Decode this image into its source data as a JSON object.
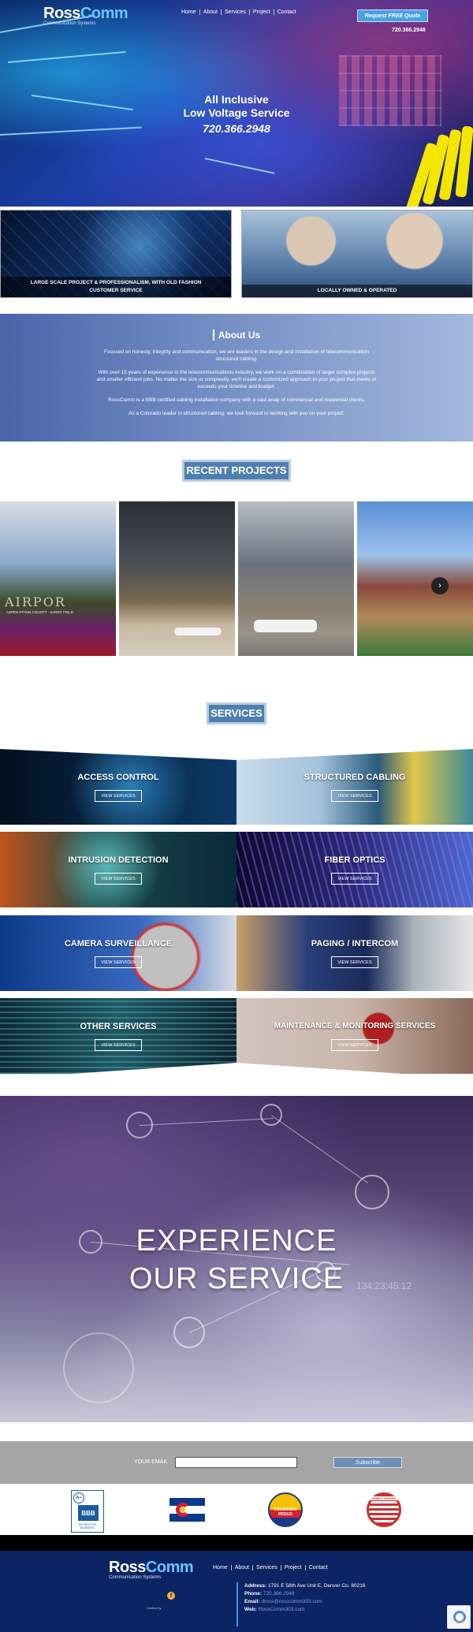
{
  "header": {
    "logo_brand_ross": "Ross",
    "logo_brand_comm": "Comm",
    "logo_tagline": "Communication Systems",
    "nav": [
      "Home",
      "About",
      "Services",
      "Project",
      "Contact"
    ],
    "quote_button": "Request FREE Quote",
    "phone": "720.366.2948"
  },
  "hero": {
    "title_line1": "All Inclusive",
    "title_line2": "Low Voltage Service",
    "phone": "720.366.2948"
  },
  "features": [
    {
      "caption": "LARGE SCALE PROJECT & PROFESSIONALISM, WITH OLD FASHION CUSTOMER SERVICE"
    },
    {
      "caption": "LOCALLY OWNED & OPERATED"
    }
  ],
  "about": {
    "title": "About Us",
    "paragraphs": [
      "Focused on honesty, integrity and communication, we are leaders in the design and installation of telecommunication structured cabling.",
      "With over 15 years of experience in the telecommunications industry, we work on a combination of larger complex projects and smaller efficient jobs. No matter the size or complexity, we'll create a customized approach to your project that meets or exceeds your timeline and budget.",
      "RossComm is a BBB certified cabling installation company with a vast array of commercial and residential clients.",
      "As a Colorado leader in structured cabling, we look forward to working with you on your project."
    ]
  },
  "projects": {
    "title": "RECENT PROJECTS",
    "airport_sign": "AIRPOR",
    "airport_subsign": "ASPEN-PITKIN COUNTY · SARDY FIELD",
    "next_icon": "›"
  },
  "services": {
    "title": "SERVICES",
    "button_label": "VIEW SERVICES",
    "items": [
      {
        "title": "ACCESS CONTROL"
      },
      {
        "title": "STRUCTURED CABLING"
      },
      {
        "title": "INTRUSION DETECTION"
      },
      {
        "title": "FIBER OPTICS"
      },
      {
        "title": "CAMERA SURVEILLANCE"
      },
      {
        "title": "PAGING / INTERCOM"
      },
      {
        "title": "OTHER SERVICES"
      },
      {
        "title": "MAINTENANCE & MONITORING SERVICES"
      }
    ]
  },
  "experience": {
    "line1": "EXPERIENCE",
    "line2": "OUR SERVICE",
    "code": "134:23:45:12"
  },
  "subscribe": {
    "label": "YOUR EMAIL",
    "value": "",
    "button": "Subscribe"
  },
  "badges": {
    "bbb_rating": "A+",
    "bbb_logo": "BBB",
    "bbb_text": "ACCREDITED BUSINESS",
    "colorado_proud": "COLORADO PROUD",
    "family_owned": "FAMILY OWNED"
  },
  "footer": {
    "credit": "Crafted by",
    "address_label": "Address:",
    "address": "1791 E 58th Ave Unit E, Denver Co. 80216",
    "phone_label": "Phone:",
    "phone": "720.366.2948",
    "email_label": "Email:",
    "email": "dross@rosscomm303.com",
    "web_label": "Web:",
    "web": "RossComm303.com"
  },
  "colors": {
    "accent": "#4aa0e8",
    "section_title_bg": "#4f7fb0",
    "footer_bg": "#0b2463",
    "about_bg": "#6f8ac2"
  }
}
